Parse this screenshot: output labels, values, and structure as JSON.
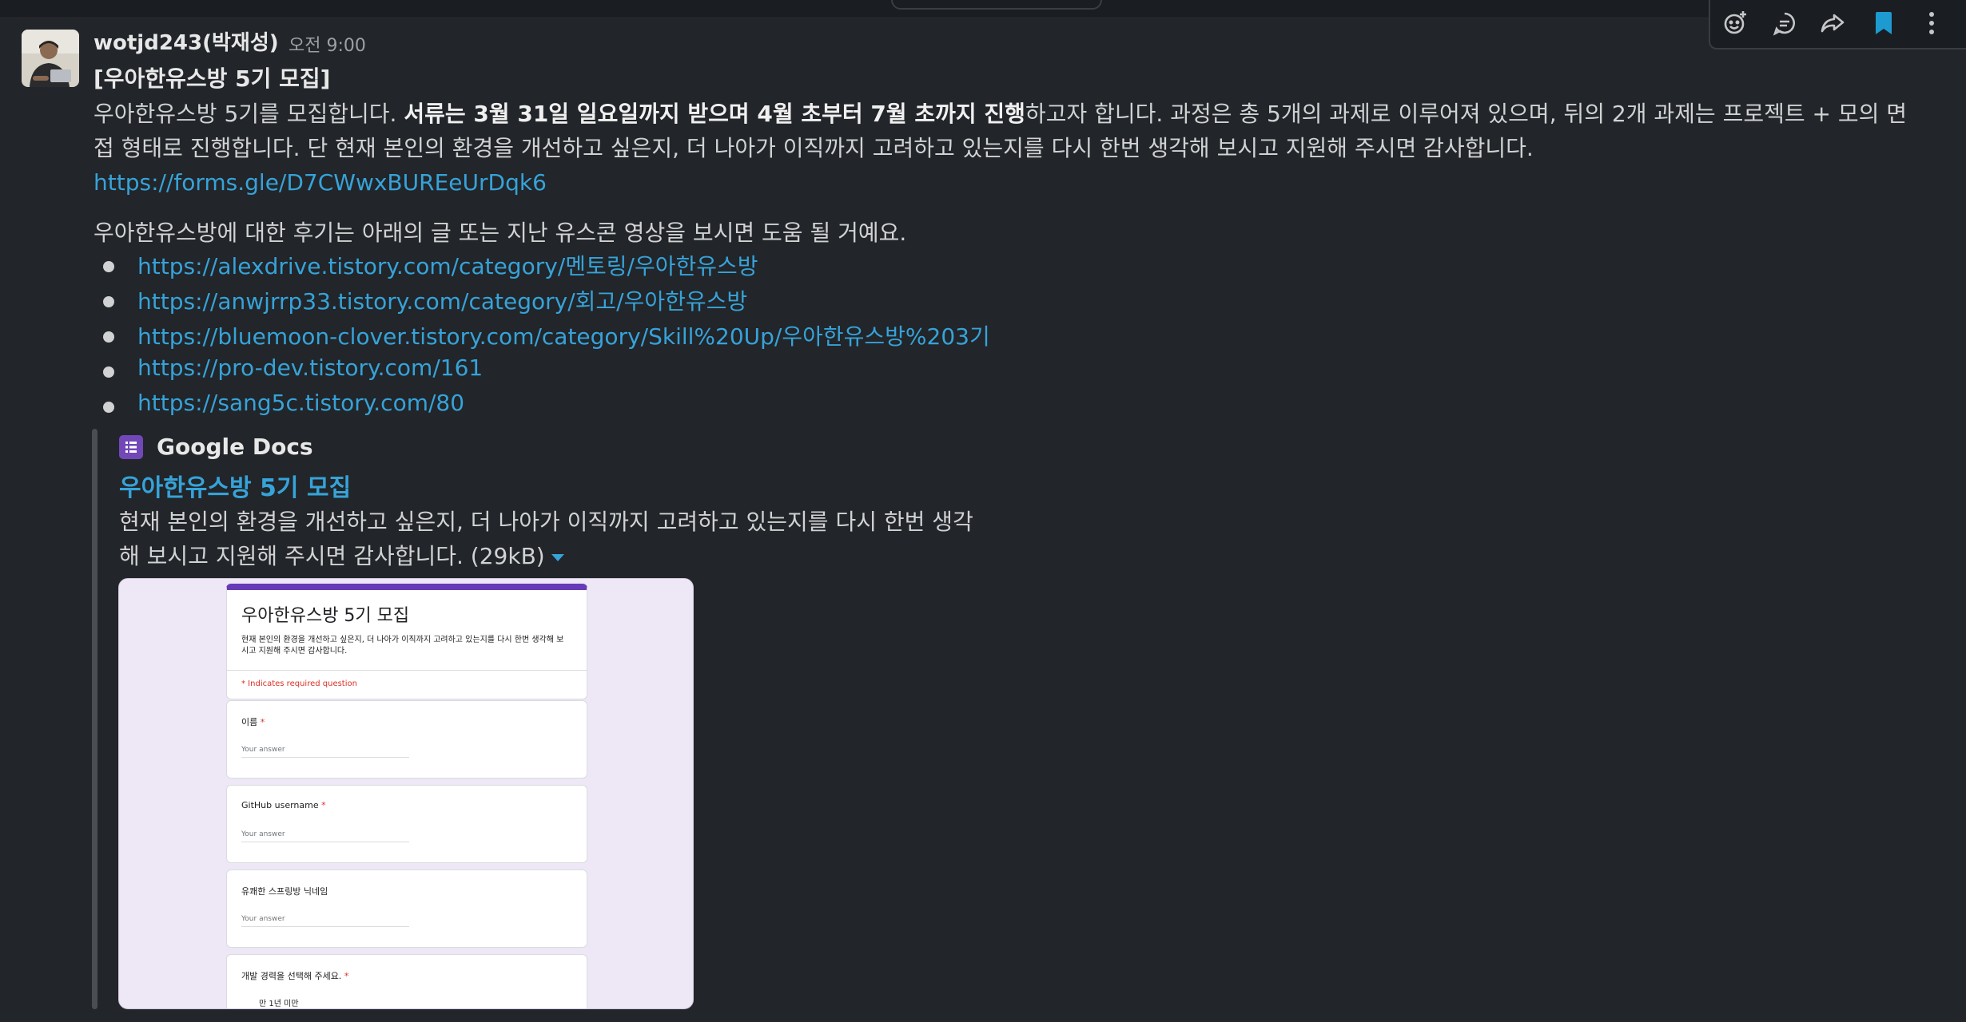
{
  "message": {
    "sender": "wotjd243(박재성)",
    "time": "오전 9:00",
    "title": "[우아한유스방 5기 모집]",
    "p1_a": "우아한유스방 5기를 모집합니다. ",
    "p1_b": "서류는 3월 31일 일요일까지 받으며 4월 초부터 7월 초까지 진행",
    "p1_c": "하고자 합니다. 과정은 총 5개의 과제로 이루어져 있으며, 뒤의 2개 과제는 프로젝트 + 모의 면",
    "p2": "접 형태로 진행합니다. 단 현재 본인의 환경을 개선하고 싶은지, 더 나아가 이직까지 고려하고 있는지를 다시 한번 생각해 보시고 지원해 주시면 감사합니다.",
    "form_link": "https://forms.gle/D7CWwxBUREeUrDqk6",
    "intro": "우아한유스방에 대한 후기는 아래의 글 또는 지난 유스콘 영상을 보시면 도움 될 거예요.",
    "links": [
      "https://alexdrive.tistory.com/category/멘토링/우아한유스방",
      "https://anwjrrp33.tistory.com/category/회고/우아한유스방",
      "https://bluemoon-clover.tistory.com/category/Skill%20Up/우아한유스방%203기",
      "https://pro-dev.tistory.com/161",
      "https://sang5c.tistory.com/80"
    ]
  },
  "attachment": {
    "source": "Google Docs",
    "title": "우아한유스방 5기 모집",
    "desc_line1": "현재 본인의 환경을 개선하고 싶은지, 더 나아가 이직까지 고려하고 있는지를 다시 한번 생각",
    "desc_line2": "해 보시고 지원해 주시면 감사합니다. (29kB)"
  },
  "form_preview": {
    "title": "우아한유스방 5기 모집",
    "description": "현재 본인의 환경을 개선하고 싶은지, 더 나아가 이직까지 고려하고 있는지를 다시 한번 생각해 보시고 지원해 주시면 감사합니다.",
    "required_note": "* Indicates required question",
    "answer_placeholder": "Your answer",
    "q1": "이름",
    "q2": "GitHub username",
    "q3": "유쾌한 스프링방 닉네임",
    "q4": "개발 경력을 선택해 주세요.",
    "q4_option": "만 1년 미만",
    "star": "*"
  },
  "colors": {
    "background": "#222529",
    "link": "#36a3d9",
    "bookmark": "#1d9bd1",
    "docs_purple": "#673ab7"
  },
  "icons": [
    "add-reaction-icon",
    "reply-thread-icon",
    "share-icon",
    "bookmark-icon",
    "more-icon",
    "list-icon"
  ]
}
